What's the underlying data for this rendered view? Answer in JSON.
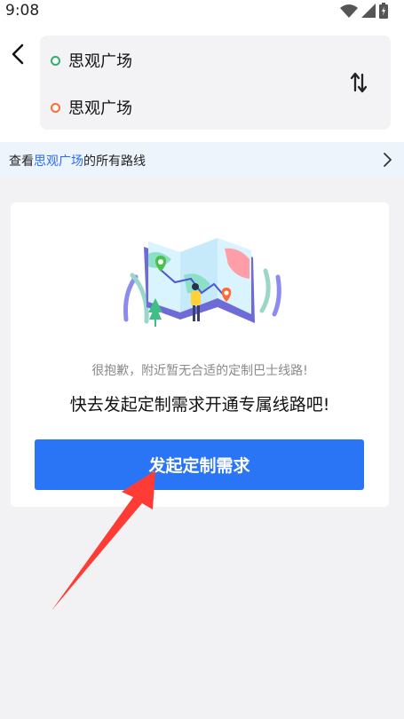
{
  "status": {
    "time": "9:08",
    "icons": [
      "wifi-icon",
      "signal-icon",
      "battery-icon"
    ]
  },
  "route": {
    "origin": "思观广场",
    "destination": "思观广场"
  },
  "banner": {
    "prefix": "查看",
    "station": "思观广场",
    "suffix": "的所有路线"
  },
  "empty": {
    "message": "很抱歉，附近暂无合适的定制巴士线路!",
    "prompt": "快去发起定制需求开通专属线路吧!",
    "button": "发起定制需求"
  },
  "colors": {
    "accent": "#2a74f6",
    "origin_dot": "#2db06d",
    "destination_dot": "#ff6a33",
    "annotation_arrow": "#ff3b35"
  }
}
